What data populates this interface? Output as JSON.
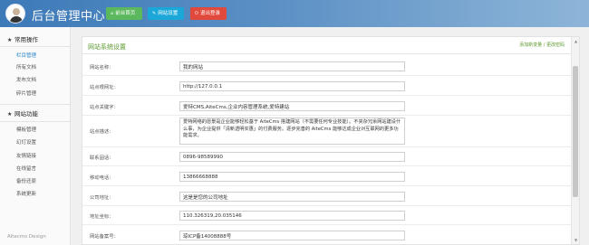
{
  "header": {
    "title": "后台管理中心",
    "buttons": [
      {
        "label": "前台首页",
        "icon": "home-icon",
        "color": "#5cb85c"
      },
      {
        "label": "网站设置",
        "icon": "wrench-icon",
        "color": "#1ba8d8"
      },
      {
        "label": "退出登录",
        "icon": "power-icon",
        "color": "#e0493b"
      }
    ]
  },
  "sidebar": {
    "sections": [
      {
        "title": "常用操作",
        "icon": "star-icon",
        "items": [
          "栏目管理",
          "所有文档",
          "发布文档",
          "碎片管理"
        ],
        "active_index": 0
      },
      {
        "title": "网站功能",
        "icon": "star-icon",
        "items": [
          "模板管理",
          "幻灯设置",
          "友情链接",
          "在线留言",
          "备份还原",
          "系统更新"
        ]
      }
    ],
    "footer": "Altecms Design"
  },
  "main": {
    "title": "网站系统设置",
    "links": "添加新变量 / 更改密码",
    "fields": [
      {
        "label": "网站名称：",
        "value": "我的网站"
      },
      {
        "label": "站点根网址：",
        "value": "http://127.0.0.1"
      },
      {
        "label": "站点关键字：",
        "value": "爱特CMS,AiteCms,企业内容管理系统,爱特建站"
      },
      {
        "label": "站点描述：",
        "value": "爱特网络的愿景是企业能够轻松基于 AiteCms 搭建网站（不需要任何专业技能）。不夹杂冗余网站建设什么事，为企业提供「清新透明实惠」的付费服务。逐步完善的 AiteCms 能够达成企业对互联网的更多功能需求。",
        "multiline": true
      },
      {
        "label": "联系固话：",
        "value": "0896-98589990"
      },
      {
        "label": "移动电话：",
        "value": "13866668888"
      },
      {
        "label": "公司地址：",
        "value": "这是是您的公司地址"
      },
      {
        "label": "地址坐标：",
        "value": "110.326319,20.035146"
      },
      {
        "label": "网站备案号：",
        "value": "琼ICP备14008888号"
      }
    ]
  },
  "colors": {
    "header_gradient_start": "#3d7ab8",
    "accent_green": "#5a9a2e",
    "active_link": "#2a86c9"
  }
}
